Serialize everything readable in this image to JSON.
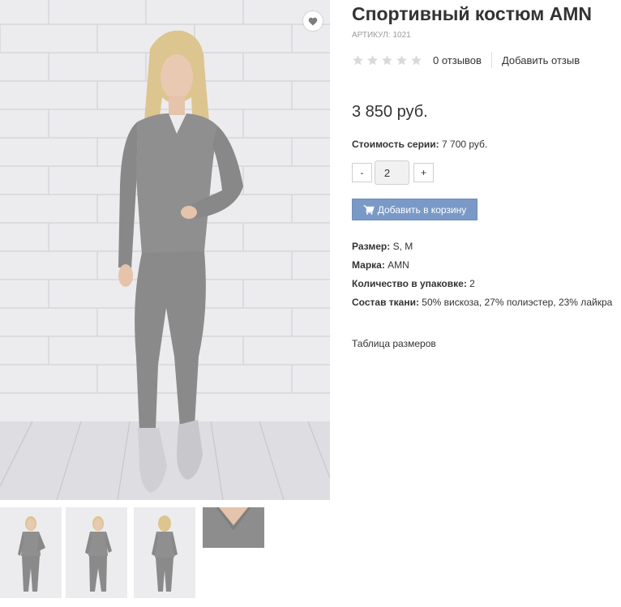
{
  "product": {
    "title": "Спортивный костюм AMN",
    "sku_label": "АРТИКУЛ:",
    "sku_value": "1021",
    "rating": {
      "stars_filled": 0,
      "stars_total": 5
    },
    "reviews_count": "0 отзывов",
    "add_review": "Добавить отзыв",
    "price": "3 850 руб.",
    "series_cost_label": "Стоимость серии:",
    "series_cost_value": "7 700 руб.",
    "quantity": {
      "minus": "-",
      "value": "2",
      "plus": "+"
    },
    "add_to_cart": "Добавить в корзину",
    "properties": [
      {
        "label": "Размер:",
        "value": "S, M"
      },
      {
        "label": "Марка:",
        "value": "AMN"
      },
      {
        "label": "Количество в упаковке:",
        "value": "2"
      },
      {
        "label": "Состав ткани:",
        "value": "50% вискоза, 27% полиэстер, 23% лайкра"
      }
    ],
    "size_table_link": "Таблица размеров"
  },
  "icons": {
    "favorite": "heart-icon",
    "cart": "shopping-cart-icon",
    "star": "star-icon"
  },
  "colors": {
    "cart_button": "#7a99c7",
    "star_empty": "#d9d9d9",
    "sku_text": "#9a9a9a"
  }
}
